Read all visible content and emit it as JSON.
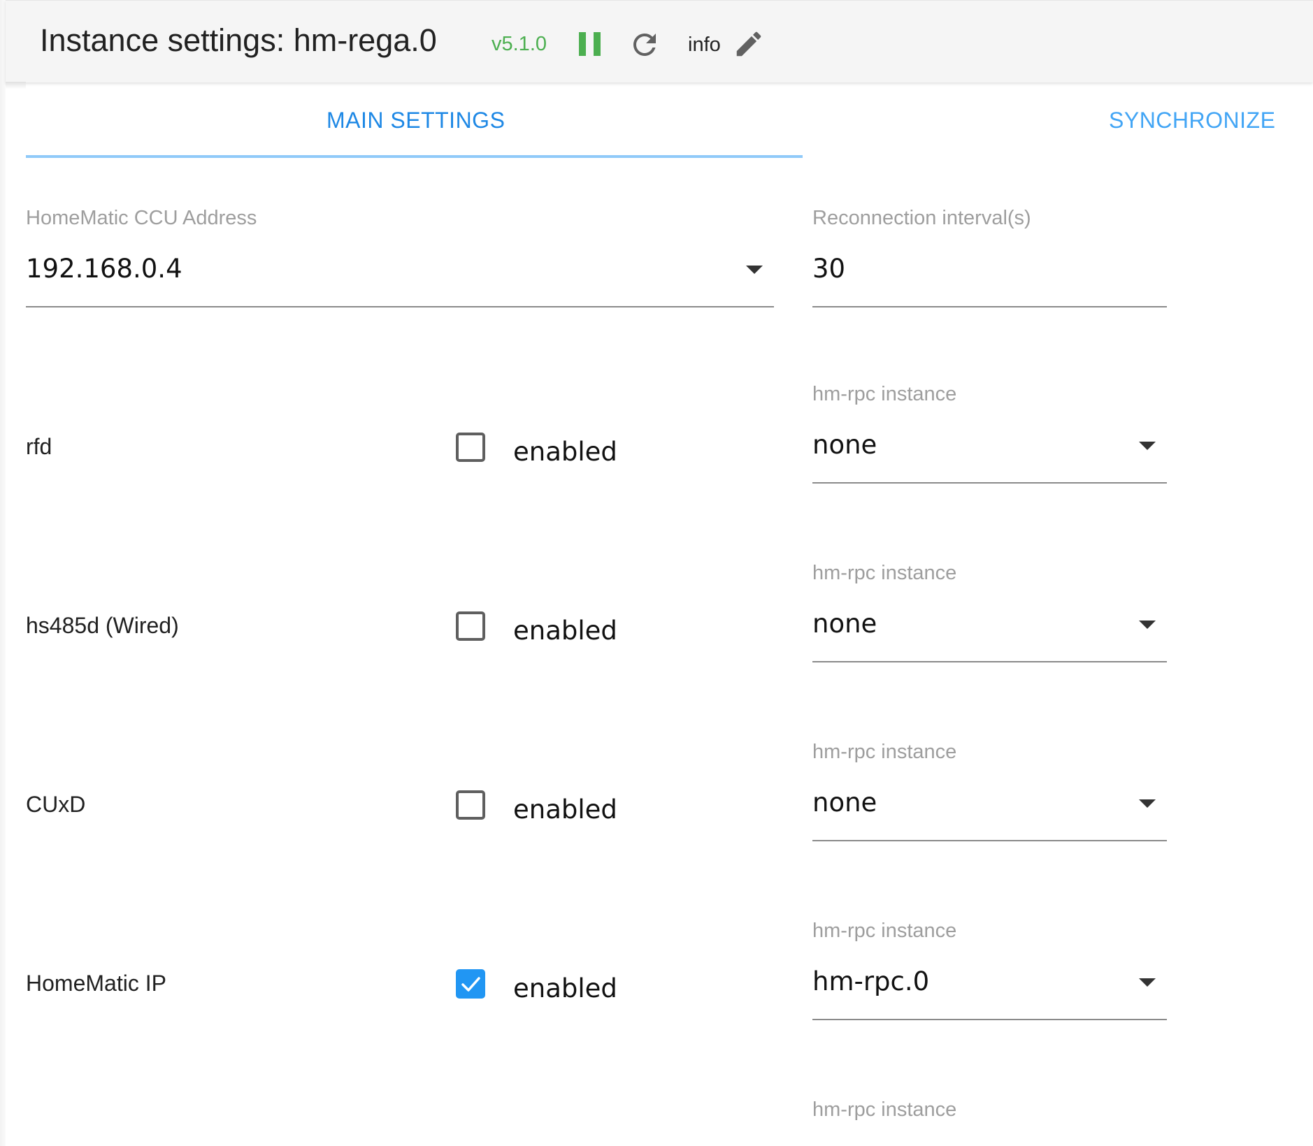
{
  "header": {
    "title": "Instance settings: hm-rega.0",
    "version": "v5.1.0",
    "info_label": "info",
    "icons": {
      "pause": "pause-icon",
      "refresh": "refresh-icon",
      "edit": "pencil-icon"
    },
    "colors": {
      "version": "#4caf50",
      "pause": "#4caf50"
    }
  },
  "tabs": [
    {
      "label": "MAIN SETTINGS",
      "active": true
    },
    {
      "label": "SYNCHRONIZE",
      "active": false
    }
  ],
  "main": {
    "ccu_address": {
      "label": "HomeMatic CCU Address",
      "value": "192.168.0.4"
    },
    "reconnect": {
      "label": "Reconnection interval(s)",
      "value": "30"
    },
    "rows": [
      {
        "name": "rfd",
        "checkbox_label": "enabled",
        "checked": false,
        "instance_label": "hm-rpc instance",
        "instance_value": "none"
      },
      {
        "name": "hs485d (Wired)",
        "checkbox_label": "enabled",
        "checked": false,
        "instance_label": "hm-rpc instance",
        "instance_value": "none"
      },
      {
        "name": "CUxD",
        "checkbox_label": "enabled",
        "checked": false,
        "instance_label": "hm-rpc instance",
        "instance_value": "none"
      },
      {
        "name": "HomeMatic IP",
        "checkbox_label": "enabled",
        "checked": true,
        "instance_label": "hm-rpc instance",
        "instance_value": "hm-rpc.0"
      },
      {
        "instance_label": "hm-rpc instance"
      }
    ]
  },
  "colors": {
    "accent": "#2196f3",
    "checkbox_checked": "#2196f3"
  }
}
